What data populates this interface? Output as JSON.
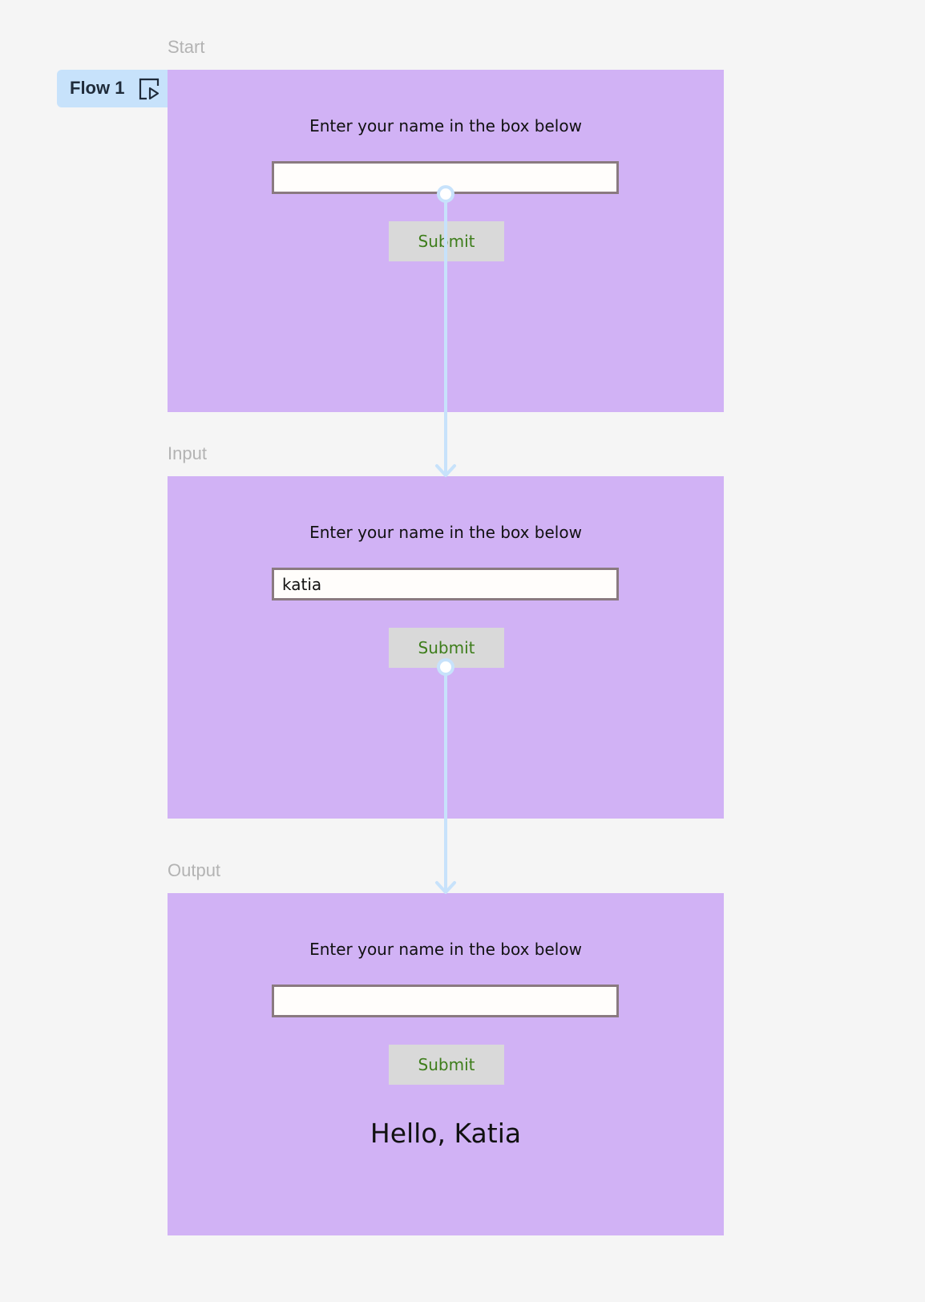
{
  "flow": {
    "label": "Flow 1",
    "icon": "play-frame-icon"
  },
  "frames": [
    {
      "label": "Start",
      "prompt": "Enter your name in the box below",
      "input_value": "",
      "button_label": "Submit",
      "greeting": ""
    },
    {
      "label": "Input",
      "prompt": "Enter your name in the box below",
      "input_value": "katia",
      "button_label": "Submit",
      "greeting": ""
    },
    {
      "label": "Output",
      "prompt": "Enter your name in the box below",
      "input_value": "",
      "button_label": "Submit",
      "greeting": "Hello, Katia"
    }
  ],
  "colors": {
    "canvas": "#f5f5f5",
    "frame": "#d1b2f5",
    "connector": "#c7e2fb",
    "button_text": "#3d7d1a",
    "input_border": "#8a7a80"
  }
}
